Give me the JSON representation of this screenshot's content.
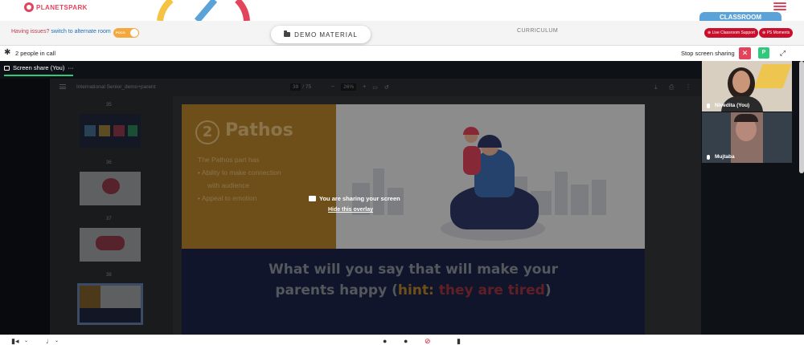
{
  "brand": {
    "logo_text": "PLANETSPARK",
    "accent": "#e2445c"
  },
  "header": {
    "classroom_tab": "CLASSROOM"
  },
  "banner": {
    "issues_text": "Having issues?",
    "alternate_link": "switch to alternate room",
    "toggle_label": "POCO",
    "demo_material": "DEMO MATERIAL",
    "curriculum": "CURRICULUM",
    "live_support": "Live Classroom Support",
    "ps_moments": "PS Moments"
  },
  "call": {
    "people": "2 people in call",
    "stop_sharing": "Stop screen sharing",
    "participant_badge": "P",
    "close_symbol": "✕"
  },
  "share": {
    "tab_label": "Screen share (You)",
    "tab_more": "···",
    "overlay_message": "You are sharing your screen",
    "overlay_hide": "Hide this overlay"
  },
  "viewer": {
    "document_title": "International Senior_demo+parent",
    "current_page": "39",
    "page_separator": "/ 75",
    "zoom": "26%",
    "thumbnails": [
      "35",
      "36",
      "37",
      "38"
    ]
  },
  "slide": {
    "number": "2",
    "heading": "Pathos",
    "line1": "The Pathos part has",
    "line2": "•  Ability to make connection",
    "line3": "with audience",
    "line4": "•  Appeal to emotion",
    "question_part1": "What will you say that will make your",
    "question_part2": "parents happy (",
    "question_hint": "hint:",
    "question_tired": " they are tired",
    "question_end": ")"
  },
  "participants": [
    {
      "name": "Nivedita (You)"
    },
    {
      "name": "Mujtaba"
    }
  ]
}
